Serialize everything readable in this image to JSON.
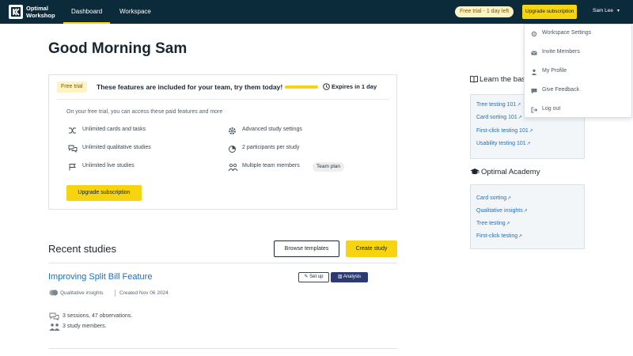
{
  "header": {
    "brand_line1": "Optimal",
    "brand_line2": "Workshop",
    "tabs": [
      {
        "label": "Dashboard",
        "active": true
      },
      {
        "label": "Workspace",
        "active": false
      }
    ],
    "trial_pill": "Free trial - 1 day left",
    "upgrade_label": "Upgrade subscription",
    "user_name": "Sam Lee"
  },
  "user_menu": {
    "items": [
      {
        "label": "Workspace Settings",
        "icon": "gear-icon"
      },
      {
        "label": "Invite Members",
        "icon": "envelope-icon"
      },
      {
        "label": "My Profile",
        "icon": "person-icon"
      },
      {
        "label": "Give Feedback",
        "icon": "chat-bubble-icon"
      },
      {
        "label": "Log out",
        "icon": "logout-icon"
      }
    ]
  },
  "main": {
    "greeting": "Good Morning Sam",
    "trial_card": {
      "badge": "Free trial",
      "headline": "These features are included for your team, try them today!",
      "expires": "Expires in 1 day",
      "subtitle": "On your free trial, you can access these paid features and more",
      "features_left": [
        {
          "label": "Unlimited cards and tasks",
          "icon": "shuffle-icon"
        },
        {
          "label": "Unlimited qualitative studies",
          "icon": "chat-icon"
        },
        {
          "label": "Unlimited live studies",
          "icon": "flag-icon"
        }
      ],
      "features_right": [
        {
          "label": "Advanced study settings",
          "icon": "settings-icon"
        },
        {
          "label": "2 participants per study",
          "icon": "pie-chart-icon"
        },
        {
          "label": "Multiple team members",
          "icon": "team-icon"
        }
      ],
      "team_badge": "Team plan",
      "upgrade_label": "Upgrade subscription"
    },
    "recent": {
      "title": "Recent studies",
      "browse_label": "Browse templates",
      "create_label": "Create study",
      "study": {
        "title": "Improving Split Bill Feature",
        "setup_label": "Set up",
        "analysis_label": "Analysis",
        "type": "Qualitative insights",
        "created": "Created Nov 06 2024",
        "sessions": "3 sessions, 47 observations.",
        "members": "3 study members."
      }
    }
  },
  "sidebar": {
    "learn_title": "Learn the basics",
    "learn_links": [
      "Tree testing 101",
      "Card sorting 101",
      "First-click testing 101",
      "Usability testing 101"
    ],
    "academy_title": "Optimal Academy",
    "academy_links": [
      "Card sorting",
      "Qualitative insights",
      "Tree testing",
      "First-click testing"
    ]
  },
  "colors": {
    "header_bg": "#0c2b3a",
    "accent_yellow": "#f6d40f",
    "link_blue": "#1c6fb8",
    "analysis_bg": "#2b3a70"
  }
}
